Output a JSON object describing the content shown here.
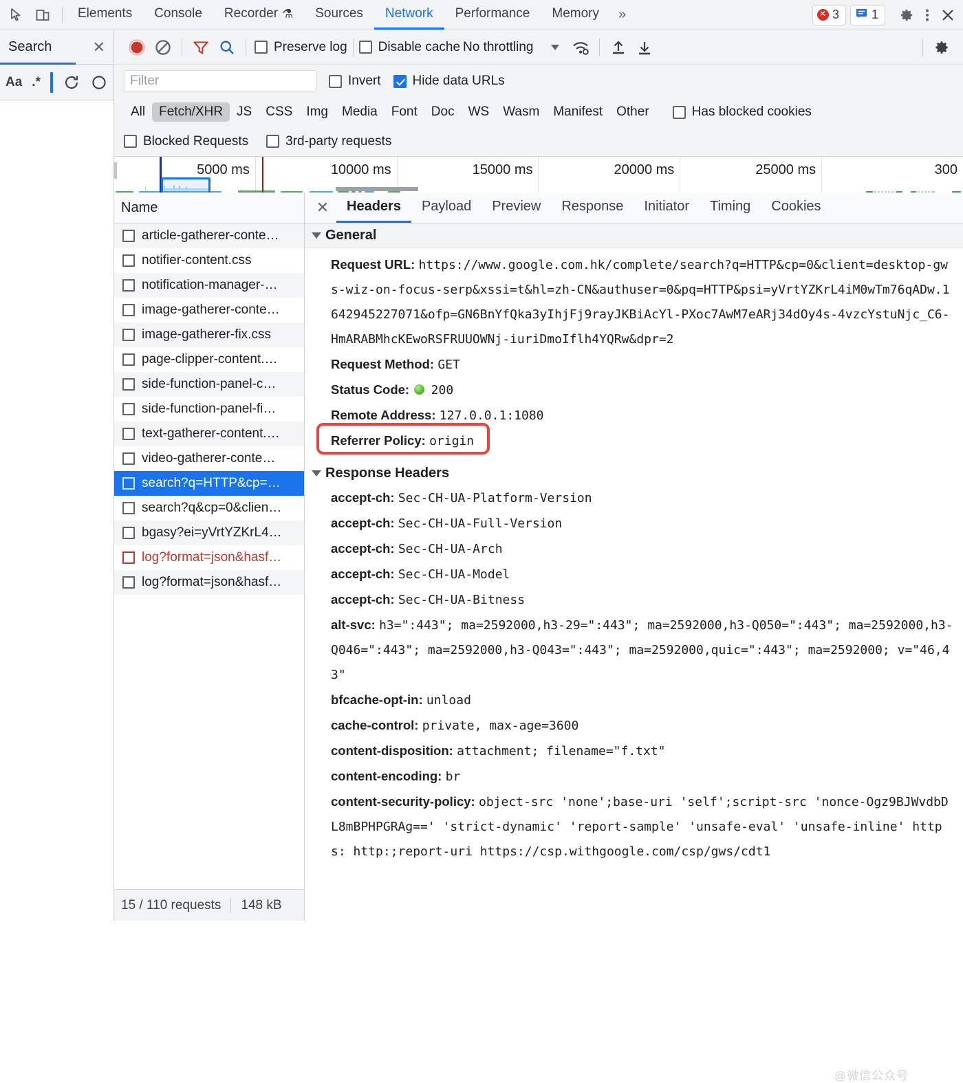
{
  "devtools": {
    "icons": {
      "inspect": "inspect-element-icon",
      "device": "device-toolbar-icon"
    },
    "tabs": [
      {
        "label": "Elements",
        "active": false
      },
      {
        "label": "Console",
        "active": false
      },
      {
        "label": "Recorder",
        "active": false,
        "suffix": "⚗"
      },
      {
        "label": "Sources",
        "active": false
      },
      {
        "label": "Network",
        "active": true
      },
      {
        "label": "Performance",
        "active": false
      },
      {
        "label": "Memory",
        "active": false
      }
    ],
    "more_label": "»",
    "error_count": "3",
    "message_count": "1",
    "settings_icon": "gear-icon",
    "kebab_icon": "more-options-icon",
    "close_icon": "close-icon"
  },
  "search_sidebar": {
    "title": "Search",
    "close_icon": "close-icon",
    "tools": [
      {
        "name": "match-case-button",
        "label": "Aa"
      },
      {
        "name": "regex-button",
        "label": ".*"
      },
      {
        "name": "text-cursor",
        "label": ""
      },
      {
        "name": "refresh-button",
        "label": "↻"
      },
      {
        "name": "clear-button",
        "label": "∅"
      }
    ]
  },
  "network_toolbar": {
    "record_icon": "record-button",
    "clear_icon": "clear-button",
    "filter_icon": "filter-icon",
    "search_icon": "search-icon",
    "preserve_log": {
      "label": "Preserve log",
      "checked": false
    },
    "disable_cache": {
      "label": "Disable cache",
      "checked": false
    },
    "throttling": {
      "value": "No throttling"
    },
    "wifi_icon": "network-conditions-icon",
    "import_icon": "import-har-icon",
    "export_icon": "export-har-icon",
    "settings_icon": "network-settings-icon",
    "filter_input": {
      "value": "",
      "placeholder": "Filter"
    },
    "invert": {
      "label": "Invert",
      "checked": false
    },
    "hide_data_urls": {
      "label": "Hide data URLs",
      "checked": true
    },
    "resource_types": [
      {
        "label": "All",
        "active": false
      },
      {
        "label": "Fetch/XHR",
        "active": true
      },
      {
        "label": "JS",
        "active": false
      },
      {
        "label": "CSS",
        "active": false
      },
      {
        "label": "Img",
        "active": false
      },
      {
        "label": "Media",
        "active": false
      },
      {
        "label": "Font",
        "active": false
      },
      {
        "label": "Doc",
        "active": false
      },
      {
        "label": "WS",
        "active": false
      },
      {
        "label": "Wasm",
        "active": false
      },
      {
        "label": "Manifest",
        "active": false
      },
      {
        "label": "Other",
        "active": false
      }
    ],
    "has_blocked_cookies": {
      "label": "Has blocked cookies",
      "checked": false
    },
    "blocked_requests": {
      "label": "Blocked Requests",
      "checked": false
    },
    "third_party_requests": {
      "label": "3rd-party requests",
      "checked": false
    }
  },
  "overview": {
    "ticks": [
      "5000 ms",
      "10000 ms",
      "15000 ms",
      "20000 ms",
      "25000 ms",
      "300"
    ]
  },
  "requests": {
    "column_header": "Name",
    "rows": [
      {
        "name": "article-gatherer-conte…",
        "state": "normal"
      },
      {
        "name": "notifier-content.css",
        "state": "normal"
      },
      {
        "name": "notification-manager-…",
        "state": "normal"
      },
      {
        "name": "image-gatherer-conte…",
        "state": "normal"
      },
      {
        "name": "image-gatherer-fix.css",
        "state": "normal"
      },
      {
        "name": "page-clipper-content.…",
        "state": "normal"
      },
      {
        "name": "side-function-panel-c…",
        "state": "normal"
      },
      {
        "name": "side-function-panel-fi…",
        "state": "normal"
      },
      {
        "name": "text-gatherer-content.…",
        "state": "normal"
      },
      {
        "name": "video-gatherer-conte…",
        "state": "normal"
      },
      {
        "name": "search?q=HTTP&cp=…",
        "state": "selected"
      },
      {
        "name": "search?q&cp=0&clien…",
        "state": "normal"
      },
      {
        "name": "bgasy?ei=yVrtYZKrL4…",
        "state": "normal"
      },
      {
        "name": "log?format=json&hasf…",
        "state": "error"
      },
      {
        "name": "log?format=json&hasf…",
        "state": "normal"
      }
    ],
    "footer": {
      "requests": "15 / 110 requests",
      "transferred": "148 kB"
    }
  },
  "detail": {
    "close_icon": "close-icon",
    "tabs": [
      {
        "label": "Headers",
        "active": true
      },
      {
        "label": "Payload",
        "active": false
      },
      {
        "label": "Preview",
        "active": false
      },
      {
        "label": "Response",
        "active": false
      },
      {
        "label": "Initiator",
        "active": false
      },
      {
        "label": "Timing",
        "active": false
      },
      {
        "label": "Cookies",
        "active": false
      }
    ],
    "general": {
      "title": "General",
      "request_url_label": "Request URL:",
      "request_url_value": "https://www.google.com.hk/complete/search?q=HTTP&cp=0&client=desktop-gws-wiz-on-focus-serp&xssi=t&hl=zh-CN&authuser=0&pq=HTTP&psi=yVrtYZKrL4iM0wTm76qADw.1642945227071&ofp=GN6BnYfQka3yIhjFj9rayJKBiAcYl-PXoc7AwM7eARj34dOy4s-4vzcYstuNjc_C6-HmARABMhcKEwoRSFRUUOWNj-iuriDmoIflh4YQRw&dpr=2",
      "request_method_label": "Request Method:",
      "request_method_value": "GET",
      "status_code_label": "Status Code:",
      "status_code_value": "200",
      "status_indicator": "green-status-dot",
      "remote_address_label": "Remote Address:",
      "remote_address_value": "127.0.0.1:1080",
      "referrer_policy_label": "Referrer Policy:",
      "referrer_policy_value": "origin"
    },
    "response_headers": {
      "title": "Response Headers",
      "items": [
        {
          "name": "accept-ch:",
          "value": "Sec-CH-UA-Platform-Version"
        },
        {
          "name": "accept-ch:",
          "value": "Sec-CH-UA-Full-Version"
        },
        {
          "name": "accept-ch:",
          "value": "Sec-CH-UA-Arch"
        },
        {
          "name": "accept-ch:",
          "value": "Sec-CH-UA-Model"
        },
        {
          "name": "accept-ch:",
          "value": "Sec-CH-UA-Bitness"
        },
        {
          "name": "alt-svc:",
          "value": "h3=\":443\"; ma=2592000,h3-29=\":443\"; ma=2592000,h3-Q050=\":443\"; ma=2592000,h3-Q046=\":443\"; ma=2592000,h3-Q043=\":443\"; ma=2592000,quic=\":443\"; ma=2592000; v=\"46,43\""
        },
        {
          "name": "bfcache-opt-in:",
          "value": "unload"
        },
        {
          "name": "cache-control:",
          "value": "private, max-age=3600"
        },
        {
          "name": "content-disposition:",
          "value": "attachment; filename=\"f.txt\""
        },
        {
          "name": "content-encoding:",
          "value": "br"
        },
        {
          "name": "content-security-policy:",
          "value": "object-src 'none';base-uri 'self';script-src 'nonce-Ogz9BJWvdbDL8mBPHPGRAg==' 'strict-dynamic' 'report-sample' 'unsafe-eval' 'unsafe-inline' https: http:;report-uri https://csp.withgoogle.com/csp/gws/cdt1"
        }
      ]
    }
  },
  "colors": {
    "accent": "#1a73e8",
    "error": "#d93025",
    "highlight_box": "#e8453c",
    "status_ok": "#5bbd34",
    "toolbar_bg": "#f1f3f4"
  }
}
